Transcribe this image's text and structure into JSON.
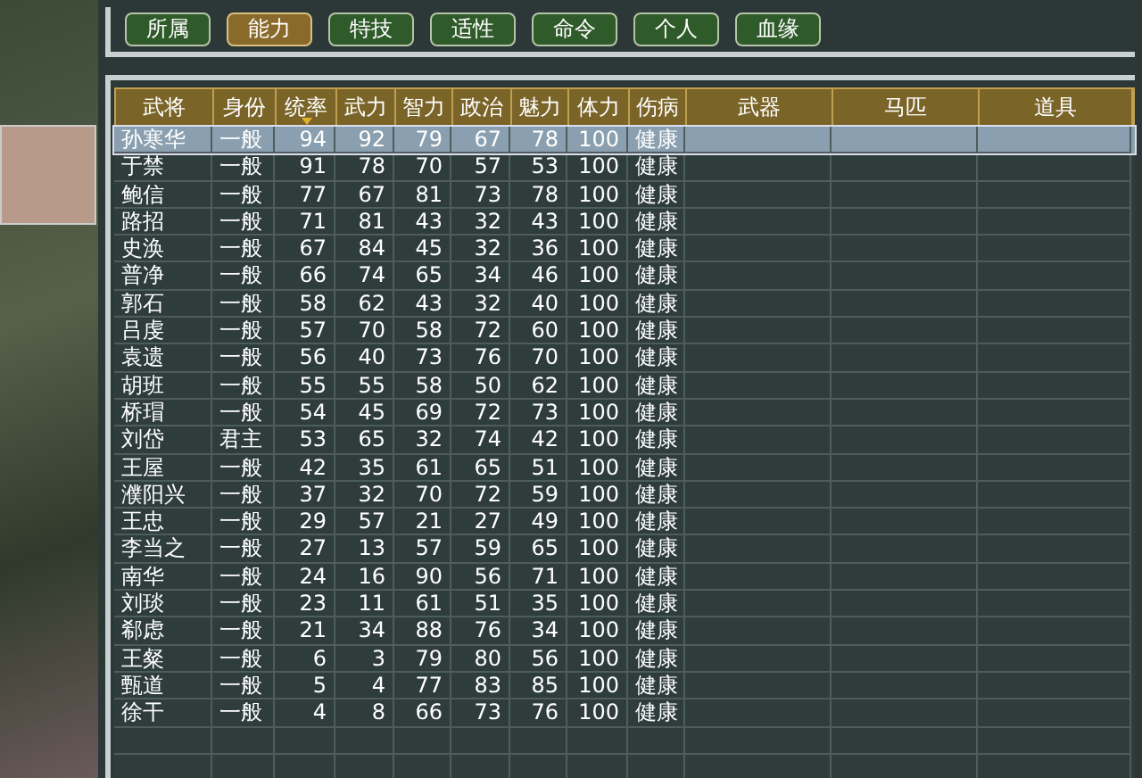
{
  "tabs": [
    {
      "label": "所属",
      "selected": false
    },
    {
      "label": "能力",
      "selected": true
    },
    {
      "label": "特技",
      "selected": false
    },
    {
      "label": "适性",
      "selected": false
    },
    {
      "label": "命令",
      "selected": false
    },
    {
      "label": "个人",
      "selected": false
    },
    {
      "label": "血缘",
      "selected": false
    }
  ],
  "table": {
    "columns": [
      {
        "label": "武将",
        "sorted": false
      },
      {
        "label": "身份",
        "sorted": false
      },
      {
        "label": "统率",
        "sorted": true
      },
      {
        "label": "武力",
        "sorted": false
      },
      {
        "label": "智力",
        "sorted": false
      },
      {
        "label": "政治",
        "sorted": false
      },
      {
        "label": "魅力",
        "sorted": false
      },
      {
        "label": "体力",
        "sorted": false
      },
      {
        "label": "伤病",
        "sorted": false
      },
      {
        "label": "武器",
        "sorted": false
      },
      {
        "label": "马匹",
        "sorted": false
      },
      {
        "label": "道具",
        "sorted": false
      }
    ],
    "rows": [
      {
        "selected": true,
        "cells": [
          "孙寒华",
          "一般",
          "94",
          "92",
          "79",
          "67",
          "78",
          "100",
          "健康"
        ]
      },
      {
        "selected": false,
        "cells": [
          "于禁",
          "一般",
          "91",
          "78",
          "70",
          "57",
          "53",
          "100",
          "健康"
        ]
      },
      {
        "selected": false,
        "cells": [
          "鲍信",
          "一般",
          "77",
          "67",
          "81",
          "73",
          "78",
          "100",
          "健康"
        ]
      },
      {
        "selected": false,
        "cells": [
          "路招",
          "一般",
          "71",
          "81",
          "43",
          "32",
          "43",
          "100",
          "健康"
        ]
      },
      {
        "selected": false,
        "cells": [
          "史涣",
          "一般",
          "67",
          "84",
          "45",
          "32",
          "36",
          "100",
          "健康"
        ]
      },
      {
        "selected": false,
        "cells": [
          "普净",
          "一般",
          "66",
          "74",
          "65",
          "34",
          "46",
          "100",
          "健康"
        ]
      },
      {
        "selected": false,
        "cells": [
          "郭石",
          "一般",
          "58",
          "62",
          "43",
          "32",
          "40",
          "100",
          "健康"
        ]
      },
      {
        "selected": false,
        "cells": [
          "吕虔",
          "一般",
          "57",
          "70",
          "58",
          "72",
          "60",
          "100",
          "健康"
        ]
      },
      {
        "selected": false,
        "cells": [
          "袁遗",
          "一般",
          "56",
          "40",
          "73",
          "76",
          "70",
          "100",
          "健康"
        ]
      },
      {
        "selected": false,
        "cells": [
          "胡班",
          "一般",
          "55",
          "55",
          "58",
          "50",
          "62",
          "100",
          "健康"
        ]
      },
      {
        "selected": false,
        "cells": [
          "桥瑁",
          "一般",
          "54",
          "45",
          "69",
          "72",
          "73",
          "100",
          "健康"
        ]
      },
      {
        "selected": false,
        "cells": [
          "刘岱",
          "君主",
          "53",
          "65",
          "32",
          "74",
          "42",
          "100",
          "健康"
        ]
      },
      {
        "selected": false,
        "cells": [
          "王屋",
          "一般",
          "42",
          "35",
          "61",
          "65",
          "51",
          "100",
          "健康"
        ]
      },
      {
        "selected": false,
        "cells": [
          "濮阳兴",
          "一般",
          "37",
          "32",
          "70",
          "72",
          "59",
          "100",
          "健康"
        ]
      },
      {
        "selected": false,
        "cells": [
          "王忠",
          "一般",
          "29",
          "57",
          "21",
          "27",
          "49",
          "100",
          "健康"
        ]
      },
      {
        "selected": false,
        "cells": [
          "李当之",
          "一般",
          "27",
          "13",
          "57",
          "59",
          "65",
          "100",
          "健康"
        ]
      },
      {
        "selected": false,
        "cells": [
          "南华",
          "一般",
          "24",
          "16",
          "90",
          "56",
          "71",
          "100",
          "健康"
        ]
      },
      {
        "selected": false,
        "cells": [
          "刘琰",
          "一般",
          "23",
          "11",
          "61",
          "51",
          "35",
          "100",
          "健康"
        ]
      },
      {
        "selected": false,
        "cells": [
          "郗虑",
          "一般",
          "21",
          "34",
          "88",
          "76",
          "34",
          "100",
          "健康"
        ]
      },
      {
        "selected": false,
        "cells": [
          "王粲",
          "一般",
          "6",
          "3",
          "79",
          "80",
          "56",
          "100",
          "健康"
        ]
      },
      {
        "selected": false,
        "cells": [
          "甄道",
          "一般",
          "5",
          "4",
          "77",
          "83",
          "85",
          "100",
          "健康"
        ]
      },
      {
        "selected": false,
        "cells": [
          "徐干",
          "一般",
          "4",
          "8",
          "66",
          "73",
          "76",
          "100",
          "健康"
        ]
      }
    ]
  }
}
